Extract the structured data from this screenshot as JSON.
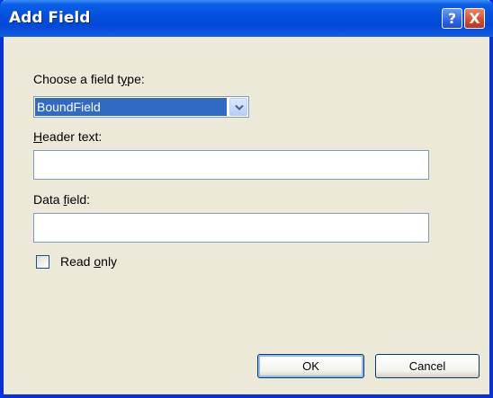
{
  "window": {
    "title": "Add Field",
    "help_button": "?",
    "close_button": "X"
  },
  "form": {
    "field_type_label_pre": "Choose a field t",
    "field_type_label_access": "y",
    "field_type_label_post": "pe:",
    "field_type_value": "BoundField",
    "header_label_access": "H",
    "header_label_post": "eader text:",
    "header_value": "",
    "data_field_label_pre": "Data ",
    "data_field_label_access": "f",
    "data_field_label_post": "ield:",
    "data_field_value": "",
    "read_only_label_pre": "Read ",
    "read_only_label_access": "o",
    "read_only_label_post": "nly",
    "read_only_checked": false
  },
  "buttons": {
    "ok_label": "OK",
    "cancel_label": "Cancel"
  },
  "colors": {
    "title_bar": "#0553de",
    "selection": "#316ac5",
    "dialog_bg": "#ece9d8"
  }
}
